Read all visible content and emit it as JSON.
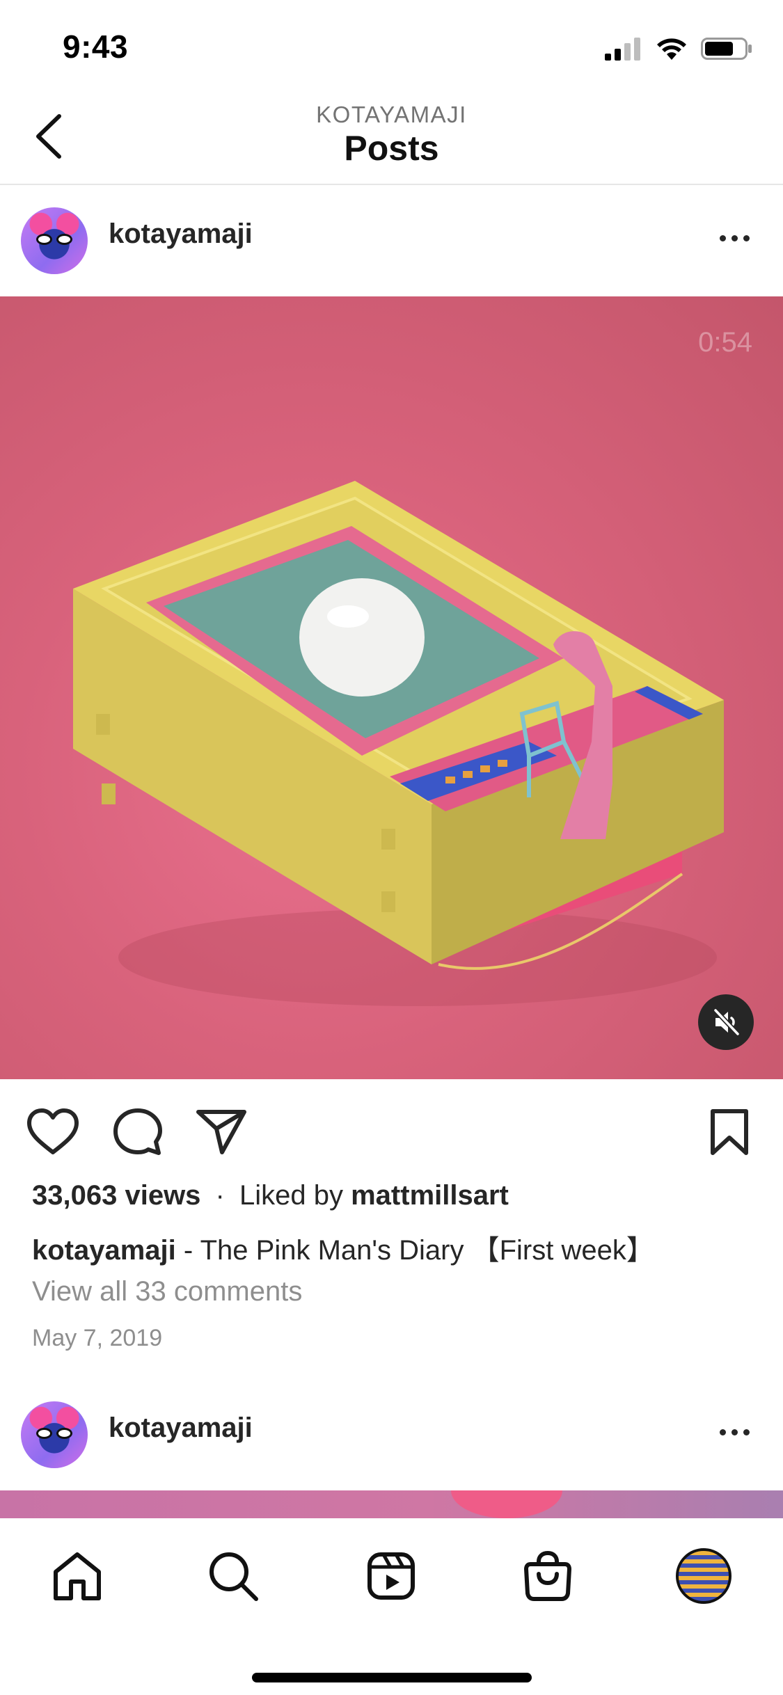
{
  "status_bar": {
    "time": "9:43"
  },
  "header": {
    "subtitle": "KOTAYAMAJI",
    "title": "Posts"
  },
  "post": {
    "username": "kotayamaji",
    "duration": "0:54",
    "views": "33,063 views",
    "separator": "·",
    "liked_by_prefix": "Liked by",
    "liked_by_user": "mattmillsart",
    "caption_user": "kotayamaji",
    "caption_text": " - The Pink Man's Diary 【First week】",
    "comments_link": "View all 33 comments",
    "date": "May 7, 2019"
  },
  "next_post": {
    "username": "kotayamaji"
  },
  "icons": {
    "back": "chevron-left-icon",
    "more": "more-horizontal-icon",
    "mute": "speaker-muted-icon",
    "like": "heart-icon",
    "comment": "comment-bubble-icon",
    "share": "paper-plane-icon",
    "save": "bookmark-icon",
    "tabs": [
      "home-icon",
      "search-icon",
      "reels-icon",
      "shop-bag-icon",
      "profile-avatar"
    ]
  },
  "colors": {
    "text": "#262626",
    "muted": "#8e8e8e",
    "media_bg": "#d8627b"
  }
}
